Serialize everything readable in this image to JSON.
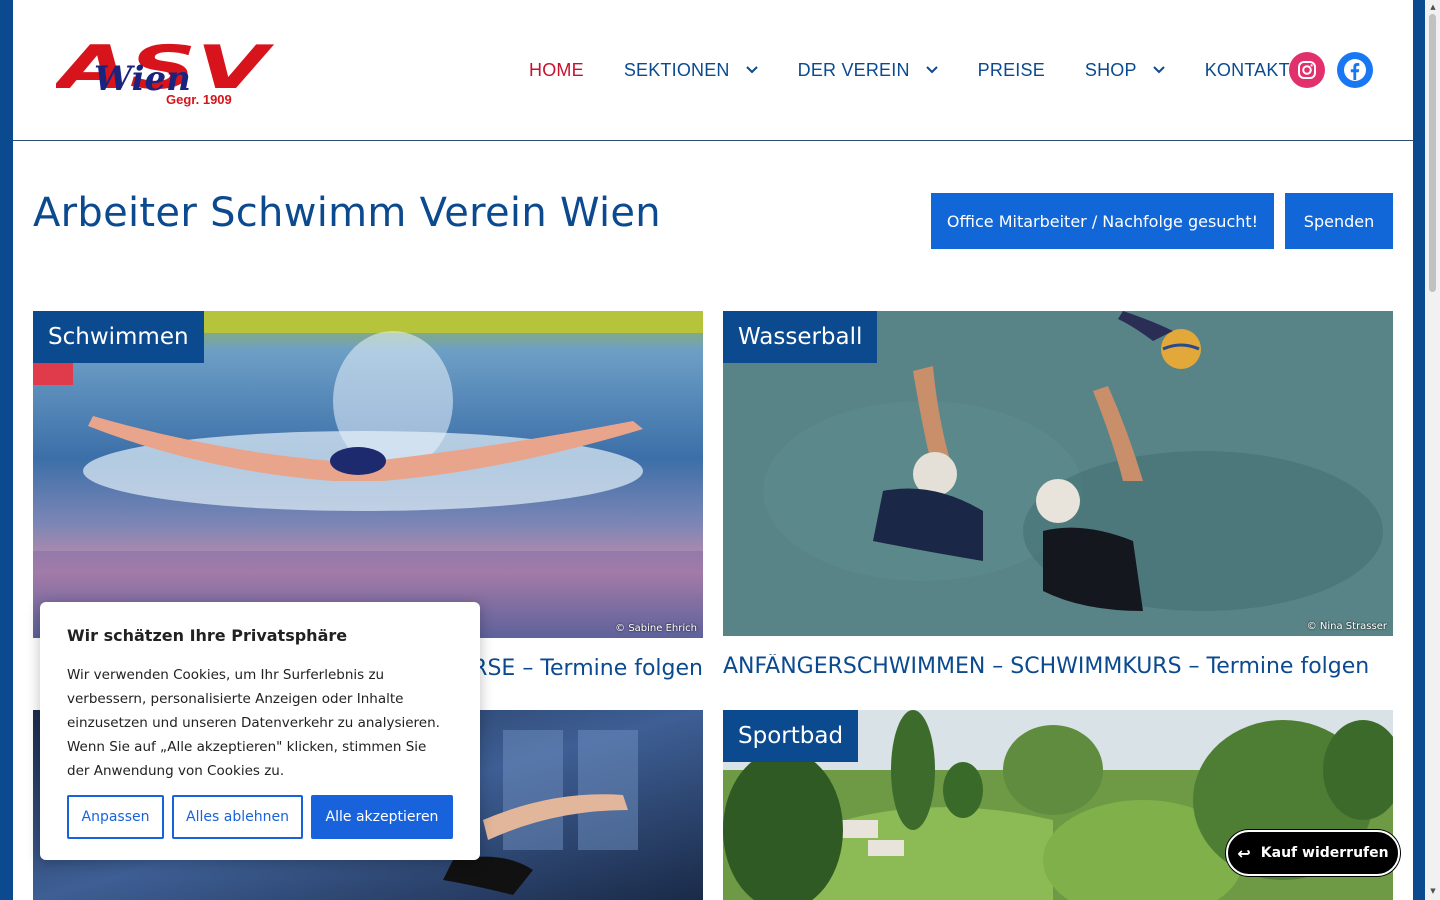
{
  "logo": {
    "text": "ASV",
    "script": "Wien",
    "subtitle": "Gegr. 1909"
  },
  "nav": {
    "items": [
      {
        "label": "HOME",
        "active": true,
        "dropdown": false
      },
      {
        "label": "SEKTIONEN",
        "active": false,
        "dropdown": true
      },
      {
        "label": "DER VEREIN",
        "active": false,
        "dropdown": true
      },
      {
        "label": "PREISE",
        "active": false,
        "dropdown": false
      },
      {
        "label": "SHOP",
        "active": false,
        "dropdown": true
      },
      {
        "label": "KONTAKT",
        "active": false,
        "dropdown": false
      }
    ],
    "social": [
      "instagram-icon",
      "facebook-icon"
    ]
  },
  "hero": {
    "title": "Arbeiter Schwimm Verein Wien",
    "buttons": {
      "office": "Office Mitarbeiter / Nachfolge gesucht!",
      "spenden": "Spenden"
    }
  },
  "cards": [
    {
      "label": "Schwimmen",
      "credit": "© Sabine Ehrich",
      "headline": "SCHWIMMKURSE – Termine folgen"
    },
    {
      "label": "Wasserball",
      "credit": "© Nina Strasser",
      "headline": "ANFÄNGERSCHWIMMEN – SCHWIMMKURS – Termine folgen"
    },
    {
      "label": "",
      "credit": "",
      "headline": ""
    },
    {
      "label": "Sportbad",
      "credit": "",
      "headline": ""
    }
  ],
  "cookie": {
    "title": "Wir schätzen Ihre Privatsphäre",
    "text": "Wir verwenden Cookies, um Ihr Surferlebnis zu verbessern, personalisierte Anzeigen oder Inhalte einzusetzen und unseren Datenverkehr zu analysieren. Wenn Sie auf „Alle akzeptieren\" klicken, stimmen Sie der Anwendung von Cookies zu.",
    "buttons": {
      "customize": "Anpassen",
      "reject": "Alles ablehnen",
      "accept": "Alle akzeptieren"
    }
  },
  "revoke": {
    "label": "Kauf widerrufen"
  },
  "colors": {
    "primary": "#0b4a8f",
    "accent_red": "#c8102e",
    "button_blue": "#1167d8",
    "cookie_blue": "#1863dc"
  }
}
